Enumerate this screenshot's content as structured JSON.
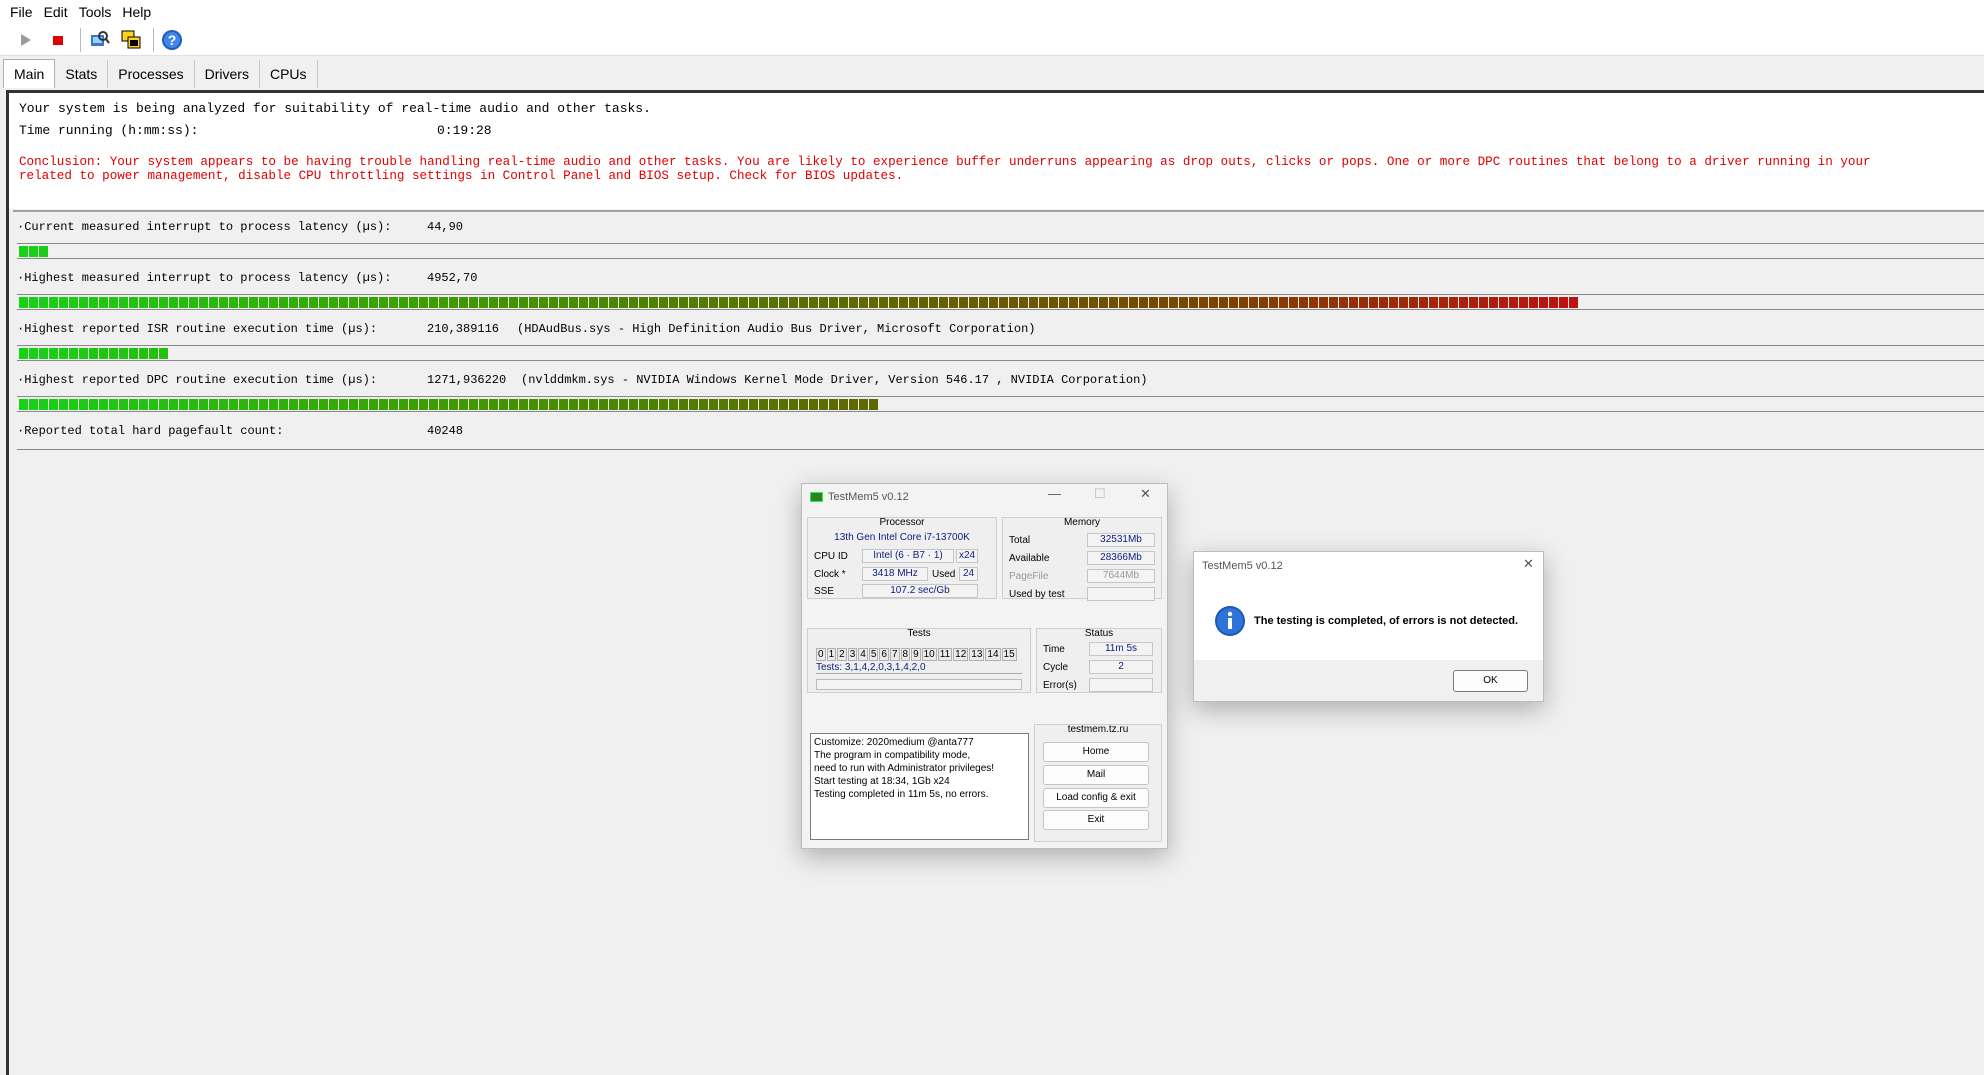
{
  "menu": [
    "File",
    "Edit",
    "Tools",
    "Help"
  ],
  "toolbar": {
    "icons": [
      "play-icon",
      "stop-icon",
      "analyze-icon",
      "windows-icon",
      "help-icon"
    ]
  },
  "tabs": [
    "Main",
    "Stats",
    "Processes",
    "Drivers",
    "CPUs"
  ],
  "main": {
    "line1": "Your system is being analyzed for suitability of real-time audio and other tasks.",
    "time_label": "Time running (h:mm:ss):",
    "time_value": "0:19:28",
    "conclusion1": "Conclusion: Your system appears to be having trouble handling real-time audio and other tasks. You are likely to experience buffer underruns appearing as drop outs, clicks or pops. One or more DPC routines that belong to a driver running in your",
    "conclusion2": "related to power management, disable CPU throttling settings in Control Panel and BIOS setup. Check for BIOS updates.",
    "metrics": [
      {
        "label": "·Current measured interrupt to process latency (µs):",
        "value": "44,90",
        "detail": "",
        "fill": 0.013
      },
      {
        "label": "·Highest measured interrupt to process latency (µs):",
        "value": "4952,70",
        "detail": "",
        "fill": 0.79
      },
      {
        "label": "·Highest reported ISR routine execution time (µs):",
        "value": "210,389116",
        "detail": "(HDAudBus.sys - High Definition Audio Bus Driver, Microsoft Corporation)",
        "fill": 0.078
      },
      {
        "label": "·Highest reported DPC routine execution time (µs):",
        "value": "1271,936220",
        "detail": "(nvlddmkm.sys - NVIDIA Windows Kernel Mode Driver, Version 546.17 , NVIDIA Corporation)",
        "fill": 0.435
      },
      {
        "label": "·Reported total hard pagefault count:",
        "value": "40248",
        "detail": "",
        "fill": 0
      }
    ]
  },
  "testmem": {
    "title": "TestMem5 v0.12",
    "processor_heading": "Processor",
    "cpu_name": "13th Gen Intel Core i7-13700K",
    "cpu_id_label": "CPU ID",
    "cpu_id_value": "Intel  (6 · B7 · 1)",
    "cpu_threads": "x24",
    "clock_label": "Clock *",
    "clock_value": "3418 MHz",
    "used_label": "Used",
    "used_value": "24",
    "sse_label": "SSE",
    "sse_value": "107.2 sec/Gb",
    "memory_heading": "Memory",
    "mem_rows": [
      {
        "label": "Total",
        "value": "32531Mb"
      },
      {
        "label": "Available",
        "value": "28366Mb"
      },
      {
        "label": "PageFile",
        "value": "7644Mb"
      },
      {
        "label": "Used by test",
        "value": ""
      }
    ],
    "tests_heading": "Tests",
    "test_numbers": [
      "0",
      "1",
      "2",
      "3",
      "4",
      "5",
      "6",
      "7",
      "8",
      "9",
      "10",
      "11",
      "12",
      "13",
      "14",
      "15"
    ],
    "tests_sequence": "Tests: 3,1,4,2,0,3,1,4,2,0",
    "status_heading": "Status",
    "status_rows": [
      {
        "label": "Time",
        "value": "11m 5s"
      },
      {
        "label": "Cycle",
        "value": "2"
      },
      {
        "label": "Error(s)",
        "value": ""
      }
    ],
    "log": "Customize: 2020medium @anta777\nThe program in compatibility mode,\nneed to run with Administrator privileges!\nStart testing at 18:34, 1Gb x24\nTesting completed in 11m 5s, no errors.",
    "site_heading": "testmem.tz.ru",
    "buttons": [
      "Home",
      "Mail",
      "Load config & exit",
      "Exit"
    ]
  },
  "dialog": {
    "title": "TestMem5 v0.12",
    "message": "The testing is completed, of errors is not detected.",
    "ok": "OK"
  },
  "colors": {
    "green": "#17d117",
    "dark_green": "#3a8f00",
    "olive": "#6b6b00",
    "red": "#c01010",
    "text_red": "#e00000"
  }
}
